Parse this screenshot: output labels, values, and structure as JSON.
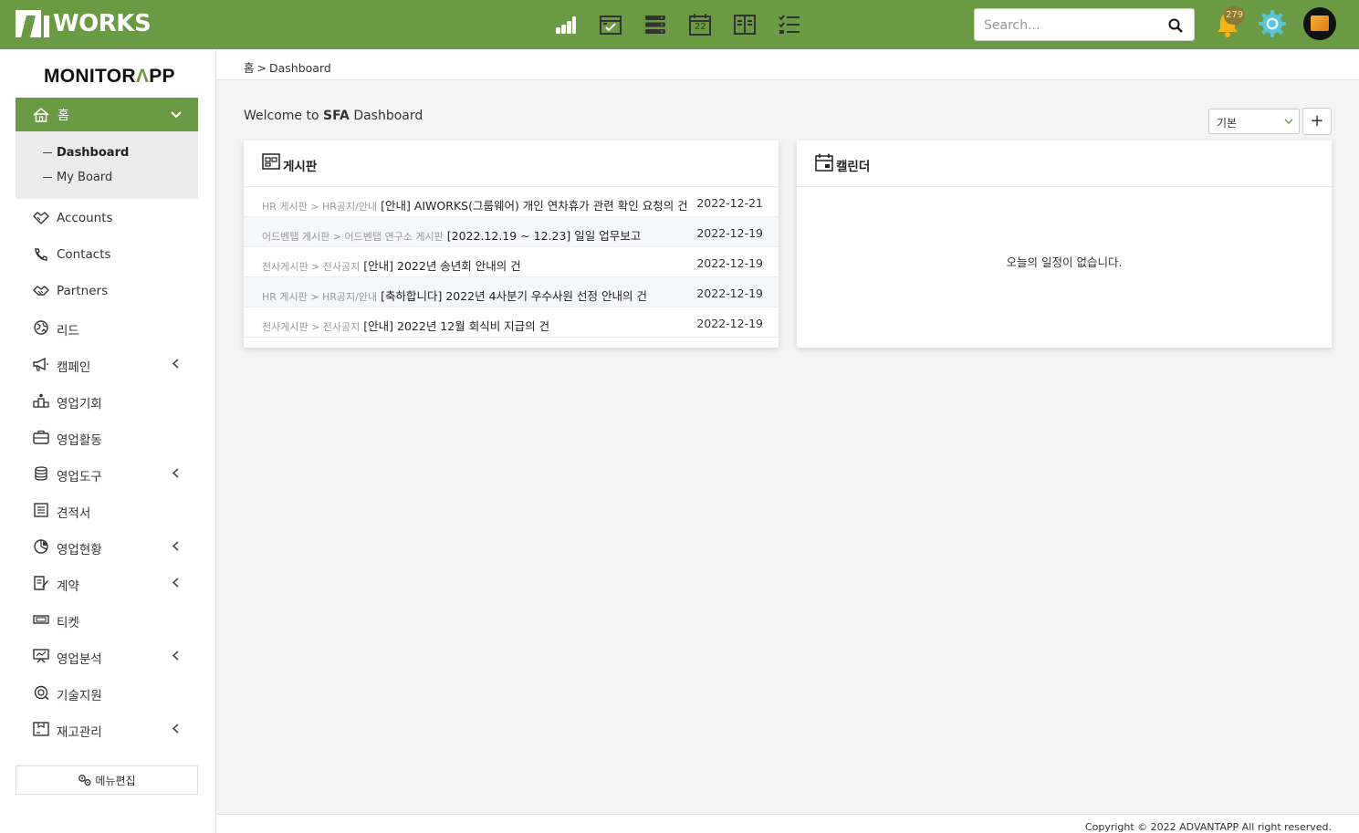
{
  "app": {
    "logo_text": "WORKS",
    "brand_left": "MONITOR",
    "brand_right": "PP"
  },
  "topbar": {
    "icons": [
      "chart-icon",
      "calendar-check-icon",
      "server-icon",
      "calendar-icon",
      "book-icon",
      "checklist-icon"
    ],
    "calendar_day": "22",
    "search_placeholder": "Search...",
    "notifications": "279",
    "accent": "#6a9a44"
  },
  "sidebar": {
    "home_label": "홈",
    "sub_items": [
      {
        "label": "Dashboard"
      },
      {
        "label": "My Board"
      }
    ],
    "items": [
      {
        "label": "Accounts",
        "icon": "handshake-icon"
      },
      {
        "label": "Contacts",
        "icon": "phone-icon"
      },
      {
        "label": "Partners",
        "icon": "partner-icon"
      },
      {
        "label": "리드",
        "icon": "globe-icon"
      },
      {
        "label": "캠페인",
        "icon": "megaphone-icon"
      },
      {
        "label": "영업기회",
        "icon": "podium-icon"
      },
      {
        "label": "영업활동",
        "icon": "briefcase-icon"
      },
      {
        "label": "영업도구",
        "icon": "database-icon"
      },
      {
        "label": "견적서",
        "icon": "quote-icon"
      },
      {
        "label": "영업현황",
        "icon": "pie-icon"
      },
      {
        "label": "계약",
        "icon": "contract-icon"
      },
      {
        "label": "티켓",
        "icon": "ticket-icon"
      },
      {
        "label": "영업분석",
        "icon": "presentation-icon"
      },
      {
        "label": "기술지원",
        "icon": "support-icon"
      },
      {
        "label": "재고관리",
        "icon": "inventory-icon"
      }
    ],
    "menu_edit": "메뉴편집"
  },
  "breadcrumb": {
    "home": "홈",
    "separator": ">",
    "current": "Dashboard"
  },
  "main": {
    "welcome_prefix": "Welcome to ",
    "welcome_bold": "SFA",
    "welcome_suffix": " Dashboard",
    "select_value": "기본",
    "add_label": "+"
  },
  "board": {
    "title": "게시판",
    "rows": [
      {
        "path": "HR 게시판 > HR공지/안내",
        "title": "[안내] AIWORKS(그룹웨어) 개인 연차휴가 관련 확인 요청의 건",
        "date": "2022-12-21"
      },
      {
        "path": "어드벤탭 게시판 > 어드벤탭 연구소 게시판",
        "title": "[2022.12.19 ~ 12.23] 일일 업무보고",
        "date": "2022-12-19"
      },
      {
        "path": "전사게시판 > 전사공지",
        "title": "[안내] 2022년 송년회 안내의 건",
        "date": "2022-12-19"
      },
      {
        "path": "HR 게시판 > HR공지/안내",
        "title": "[축하합니다] 2022년 4사분기 우수사원 선정 안내의 건",
        "date": "2022-12-19"
      },
      {
        "path": "전사게시판 > 전사공지",
        "title": "[안내] 2022년 12월 회식비 지급의 건",
        "date": "2022-12-19"
      }
    ]
  },
  "calendar": {
    "title": "캘린더",
    "empty": "오늘의 일정이 없습니다."
  },
  "footer": {
    "copyright": "Copyright © 2022 ADVANTAPP All right reserved."
  }
}
